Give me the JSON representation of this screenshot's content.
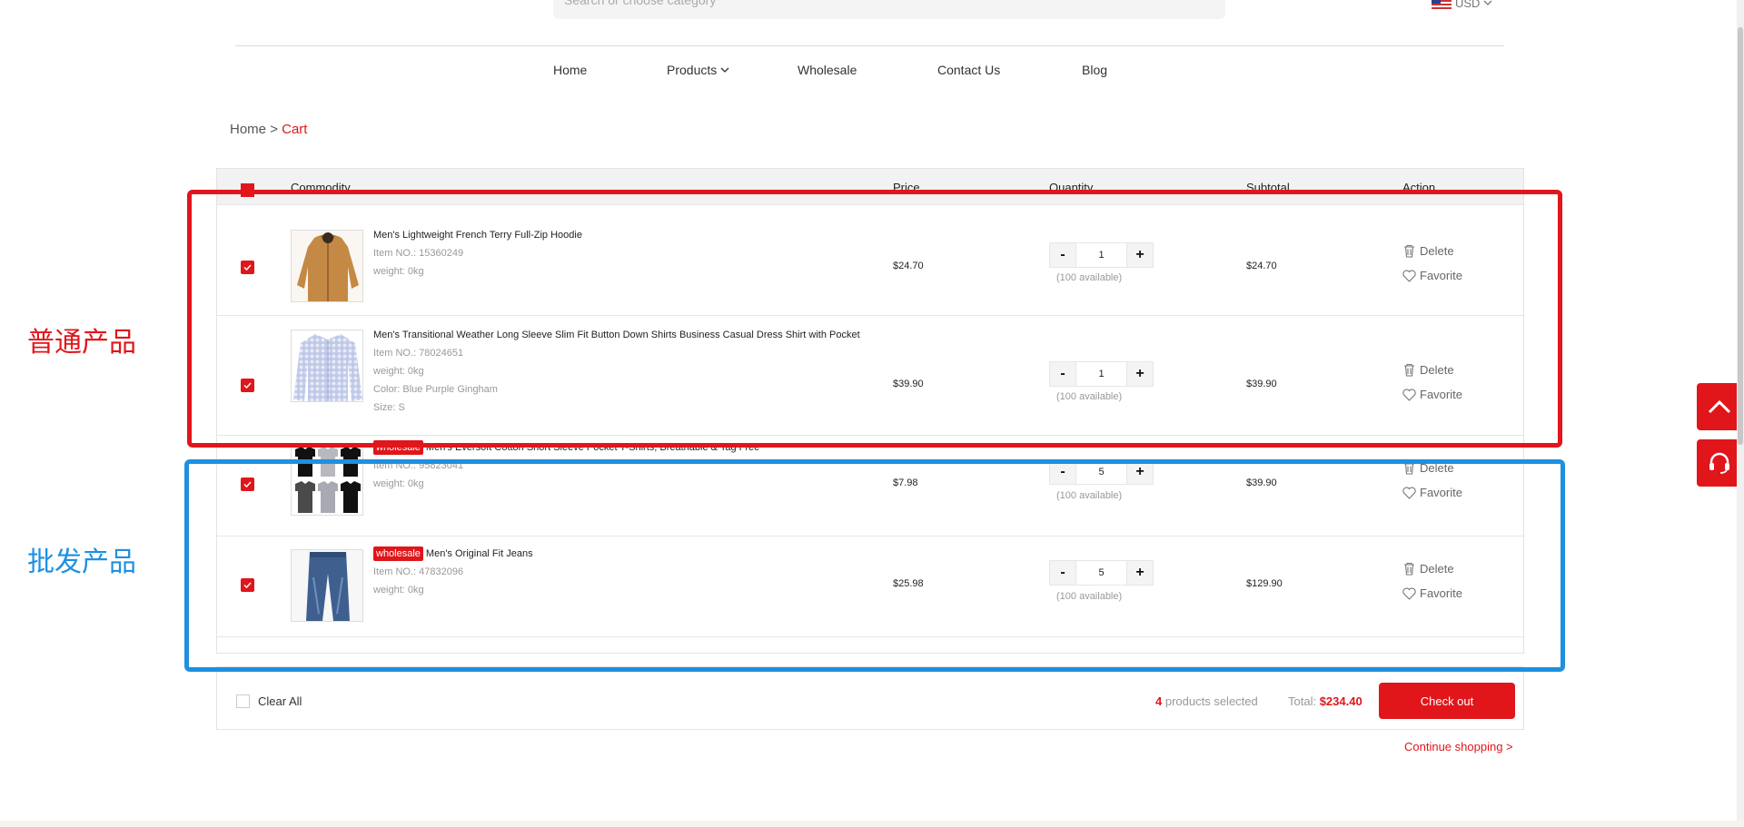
{
  "header": {
    "search_placeholder": "Search or choose category",
    "currency": "USD"
  },
  "nav": {
    "home": "Home",
    "products": "Products",
    "wholesale": "Wholesale",
    "contact": "Contact Us",
    "blog": "Blog"
  },
  "breadcrumb": {
    "home": "Home",
    "separator": ">",
    "current": "Cart"
  },
  "table": {
    "headers": {
      "commodity": "Commodity",
      "price": "Price",
      "quantity": "Quantity",
      "subtotal": "Subtotal",
      "action": "Action"
    },
    "rows": [
      {
        "tag": "",
        "name": "Men's Lightweight French Terry Full-Zip Hoodie",
        "item_no": "Item NO.: 15360249",
        "weight": "weight: 0kg",
        "color": "",
        "size": "",
        "price": "$24.70",
        "qty": "1",
        "available": "(100 available)",
        "subtotal": "$24.70",
        "delete": "Delete",
        "favorite": "Favorite"
      },
      {
        "tag": "",
        "name": "Men's Transitional Weather Long Sleeve Slim Fit Button Down Shirts Business Casual Dress Shirt with Pocket",
        "item_no": "Item NO.: 78024651",
        "weight": "weight: 0kg",
        "color": "Color: Blue Purple Gingham",
        "size": "Size: S",
        "price": "$39.90",
        "qty": "1",
        "available": "(100 available)",
        "subtotal": "$39.90",
        "delete": "Delete",
        "favorite": "Favorite"
      },
      {
        "tag": "wholesale",
        "name": "Men's Eversoft Cotton Short Sleeve Pocket T-Shirts, Breathable & Tag Free",
        "item_no": "Item NO.: 95823041",
        "weight": "weight: 0kg",
        "color": "",
        "size": "",
        "price": "$7.98",
        "qty": "5",
        "available": "(100 available)",
        "subtotal": "$39.90",
        "delete": "Delete",
        "favorite": "Favorite"
      },
      {
        "tag": "wholesale",
        "name": "Men's Original Fit Jeans",
        "item_no": "Item NO.: 47832096",
        "weight": "weight: 0kg",
        "color": "",
        "size": "",
        "price": "$25.98",
        "qty": "5",
        "available": "(100 available)",
        "subtotal": "$129.90",
        "delete": "Delete",
        "favorite": "Favorite"
      }
    ]
  },
  "qty_controls": {
    "minus": "-",
    "plus": "+"
  },
  "footer": {
    "clear_all": "Clear All",
    "selected_count": "4",
    "selected_label": "products selected",
    "total_label": "Total:",
    "total_amount": "$234.40",
    "checkout": "Check out",
    "continue": "Continue shopping >"
  },
  "annotations": {
    "normal": "普通产品",
    "wholesale": "批发产品",
    "normal_color": "#e0161b",
    "wholesale_color": "#1e90e0"
  },
  "colors": {
    "accent": "#e0161b",
    "text": "#333333",
    "muted": "#999999"
  },
  "icons": {
    "delete": "trash-icon",
    "favorite": "heart-icon",
    "back_to_top": "chevron-up-icon",
    "support": "headset-icon",
    "checkbox": "check-icon"
  }
}
